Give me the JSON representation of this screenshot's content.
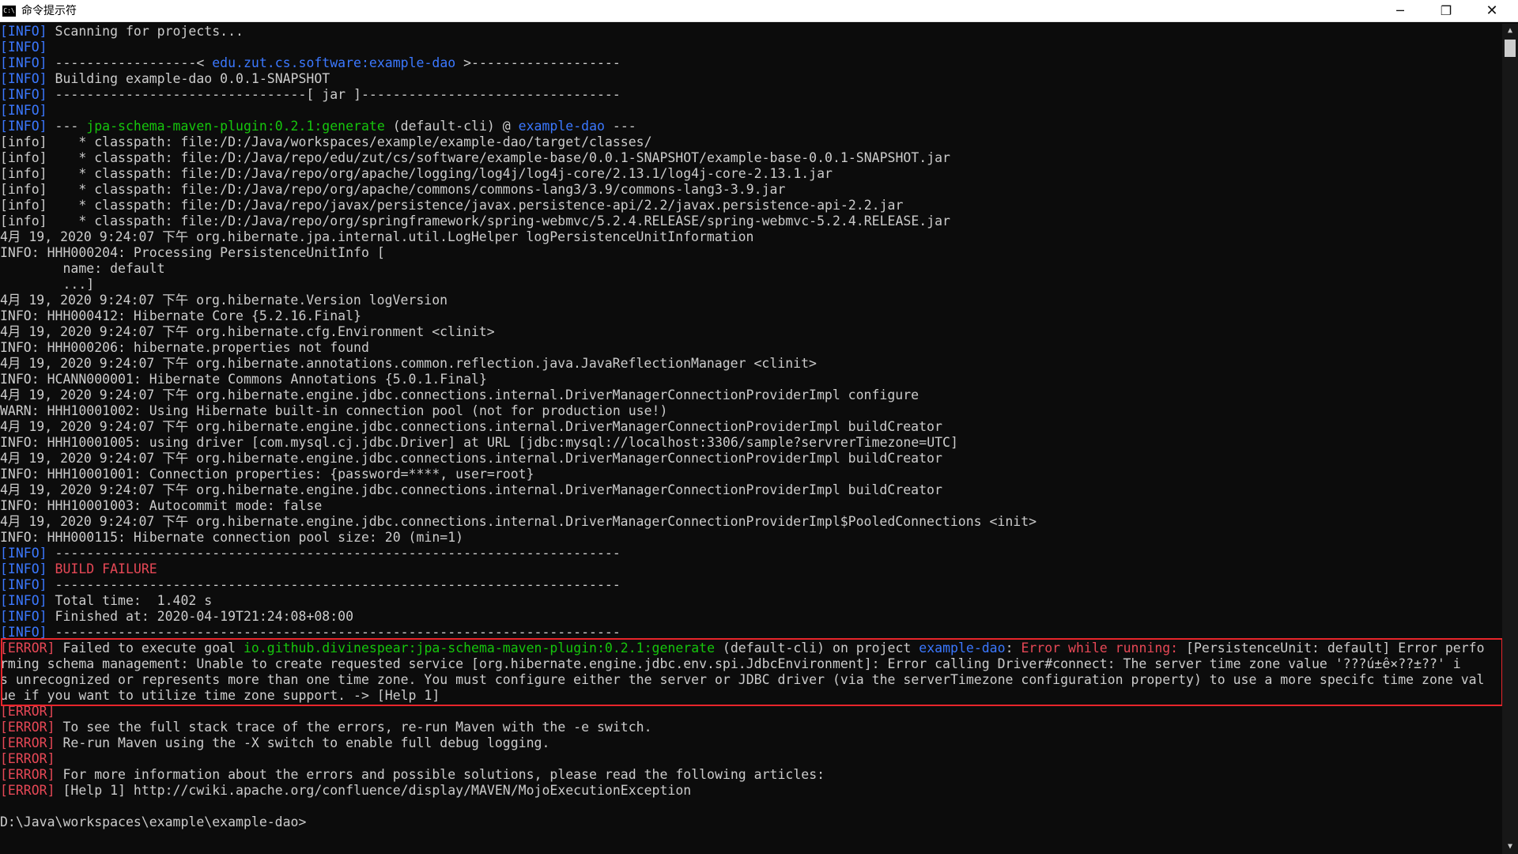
{
  "window": {
    "title": "命令提示符",
    "icon_text": "C:\\",
    "minimize_glyph": "─",
    "maximize_glyph": "❐",
    "close_glyph": "✕"
  },
  "colors": {
    "tag_info": "#3b78ff",
    "tag_error": "#e74856",
    "plugin": "#16c60c",
    "project": "#3b78ff",
    "error_highlight_box": "#e8252b",
    "background": "#0c0c0c",
    "text": "#cccccc"
  },
  "console_lines": [
    [
      {
        "t": "[INFO]",
        "c": "blue"
      },
      {
        "t": " Scanning for projects..."
      }
    ],
    [
      {
        "t": "[INFO]",
        "c": "blue"
      }
    ],
    [
      {
        "t": "[INFO]",
        "c": "blue"
      },
      {
        "t": " ------------------< "
      },
      {
        "t": "edu.zut.cs.software:example-dao",
        "c": "blue"
      },
      {
        "t": " >-------------------"
      }
    ],
    [
      {
        "t": "[INFO]",
        "c": "blue"
      },
      {
        "t": " Building example-dao 0.0.1-SNAPSHOT"
      }
    ],
    [
      {
        "t": "[INFO]",
        "c": "blue"
      },
      {
        "t": " --------------------------------[ jar ]---------------------------------"
      }
    ],
    [
      {
        "t": "[INFO]",
        "c": "blue"
      }
    ],
    [
      {
        "t": "[INFO]",
        "c": "blue"
      },
      {
        "t": " --- "
      },
      {
        "t": "jpa-schema-maven-plugin:0.2.1:generate",
        "c": "green"
      },
      {
        "t": " (default-cli) @ "
      },
      {
        "t": "example-dao",
        "c": "blue"
      },
      {
        "t": " ---"
      }
    ],
    [
      {
        "t": "[info]    * classpath: file:/D:/Java/workspaces/example/example-dao/target/classes/"
      }
    ],
    [
      {
        "t": "[info]    * classpath: file:/D:/Java/repo/edu/zut/cs/software/example-base/0.0.1-SNAPSHOT/example-base-0.0.1-SNAPSHOT.jar"
      }
    ],
    [
      {
        "t": "[info]    * classpath: file:/D:/Java/repo/org/apache/logging/log4j/log4j-core/2.13.1/log4j-core-2.13.1.jar"
      }
    ],
    [
      {
        "t": "[info]    * classpath: file:/D:/Java/repo/org/apache/commons/commons-lang3/3.9/commons-lang3-3.9.jar"
      }
    ],
    [
      {
        "t": "[info]    * classpath: file:/D:/Java/repo/javax/persistence/javax.persistence-api/2.2/javax.persistence-api-2.2.jar"
      }
    ],
    [
      {
        "t": "[info]    * classpath: file:/D:/Java/repo/org/springframework/spring-webmvc/5.2.4.RELEASE/spring-webmvc-5.2.4.RELEASE.jar"
      }
    ],
    [
      {
        "t": "4月 19, 2020 9:24:07 下午 org.hibernate.jpa.internal.util.LogHelper logPersistenceUnitInformation"
      }
    ],
    [
      {
        "t": "INFO: HHH000204: Processing PersistenceUnitInfo ["
      }
    ],
    [
      {
        "t": "        name: default"
      }
    ],
    [
      {
        "t": "        ...]"
      }
    ],
    [
      {
        "t": "4月 19, 2020 9:24:07 下午 org.hibernate.Version logVersion"
      }
    ],
    [
      {
        "t": "INFO: HHH000412: Hibernate Core {5.2.16.Final}"
      }
    ],
    [
      {
        "t": "4月 19, 2020 9:24:07 下午 org.hibernate.cfg.Environment <clinit>"
      }
    ],
    [
      {
        "t": "INFO: HHH000206: hibernate.properties not found"
      }
    ],
    [
      {
        "t": "4月 19, 2020 9:24:07 下午 org.hibernate.annotations.common.reflection.java.JavaReflectionManager <clinit>"
      }
    ],
    [
      {
        "t": "INFO: HCANN000001: Hibernate Commons Annotations {5.0.1.Final}"
      }
    ],
    [
      {
        "t": "4月 19, 2020 9:24:07 下午 org.hibernate.engine.jdbc.connections.internal.DriverManagerConnectionProviderImpl configure"
      }
    ],
    [
      {
        "t": "WARN: HHH10001002: Using Hibernate built-in connection pool (not for production use!)"
      }
    ],
    [
      {
        "t": "4月 19, 2020 9:24:07 下午 org.hibernate.engine.jdbc.connections.internal.DriverManagerConnectionProviderImpl buildCreator"
      }
    ],
    [
      {
        "t": "INFO: HHH10001005: using driver [com.mysql.cj.jdbc.Driver] at URL [jdbc:mysql://localhost:3306/sample?servrerTimezone=UTC]"
      }
    ],
    [
      {
        "t": "4月 19, 2020 9:24:07 下午 org.hibernate.engine.jdbc.connections.internal.DriverManagerConnectionProviderImpl buildCreator"
      }
    ],
    [
      {
        "t": "INFO: HHH10001001: Connection properties: {password=****, user=root}"
      }
    ],
    [
      {
        "t": "4月 19, 2020 9:24:07 下午 org.hibernate.engine.jdbc.connections.internal.DriverManagerConnectionProviderImpl buildCreator"
      }
    ],
    [
      {
        "t": "INFO: HHH10001003: Autocommit mode: false"
      }
    ],
    [
      {
        "t": "4月 19, 2020 9:24:07 下午 org.hibernate.engine.jdbc.connections.internal.DriverManagerConnectionProviderImpl$PooledConnections <init>"
      }
    ],
    [
      {
        "t": "INFO: HHH000115: Hibernate connection pool size: 20 (min=1)"
      }
    ],
    [
      {
        "t": "[INFO]",
        "c": "blue"
      },
      {
        "t": " ------------------------------------------------------------------------"
      }
    ],
    [
      {
        "t": "[INFO]",
        "c": "blue"
      },
      {
        "t": " "
      },
      {
        "t": "BUILD FAILURE",
        "c": "red"
      }
    ],
    [
      {
        "t": "[INFO]",
        "c": "blue"
      },
      {
        "t": " ------------------------------------------------------------------------"
      }
    ],
    [
      {
        "t": "[INFO]",
        "c": "blue"
      },
      {
        "t": " Total time:  1.402 s"
      }
    ],
    [
      {
        "t": "[INFO]",
        "c": "blue"
      },
      {
        "t": " Finished at: 2020-04-19T21:24:08+08:00"
      }
    ],
    [
      {
        "t": "[INFO]",
        "c": "blue"
      },
      {
        "t": " ------------------------------------------------------------------------"
      }
    ],
    [
      {
        "t": "[ERROR]",
        "c": "red"
      },
      {
        "t": " Failed to execute goal "
      },
      {
        "t": "io.github.divinespear:jpa-schema-maven-plugin:0.2.1:generate",
        "c": "green"
      },
      {
        "t": " (default-cli) on project "
      },
      {
        "t": "example-dao",
        "c": "blue"
      },
      {
        "t": ": "
      },
      {
        "t": "Error while running:",
        "c": "red"
      },
      {
        "t": " [PersistenceUnit: default] Error perfo"
      }
    ],
    [
      {
        "t": "rming schema management: Unable to create requested service [org.hibernate.engine.jdbc.env.spi.JdbcEnvironment]: Error calling Driver#connect: The server time zone value '???ú±ê×??±??' i"
      }
    ],
    [
      {
        "t": "s unrecognized or represents more than one time zone. You must configure either the server or JDBC driver (via the serverTimezone configuration property) to use a more specifc time zone val"
      }
    ],
    [
      {
        "t": "ue if you want to utilize time zone support. -> [Help 1]"
      }
    ],
    [
      {
        "t": "[ERROR]",
        "c": "red"
      }
    ],
    [
      {
        "t": "[ERROR]",
        "c": "red"
      },
      {
        "t": " To see the full stack trace of the errors, re-run Maven with the -e switch."
      }
    ],
    [
      {
        "t": "[ERROR]",
        "c": "red"
      },
      {
        "t": " Re-run Maven using the -X switch to enable full debug logging."
      }
    ],
    [
      {
        "t": "[ERROR]",
        "c": "red"
      }
    ],
    [
      {
        "t": "[ERROR]",
        "c": "red"
      },
      {
        "t": " For more information about the errors and possible solutions, please read the following articles:"
      }
    ],
    [
      {
        "t": "[ERROR]",
        "c": "red"
      },
      {
        "t": " [Help 1] http://cwiki.apache.org/confluence/display/MAVEN/MojoExecutionException"
      }
    ],
    [
      {
        "t": ""
      }
    ],
    [
      {
        "t": "D:\\Java\\workspaces\\example\\example-dao>"
      }
    ]
  ],
  "scrollbar": {
    "up_glyph": "▲",
    "down_glyph": "▼"
  }
}
